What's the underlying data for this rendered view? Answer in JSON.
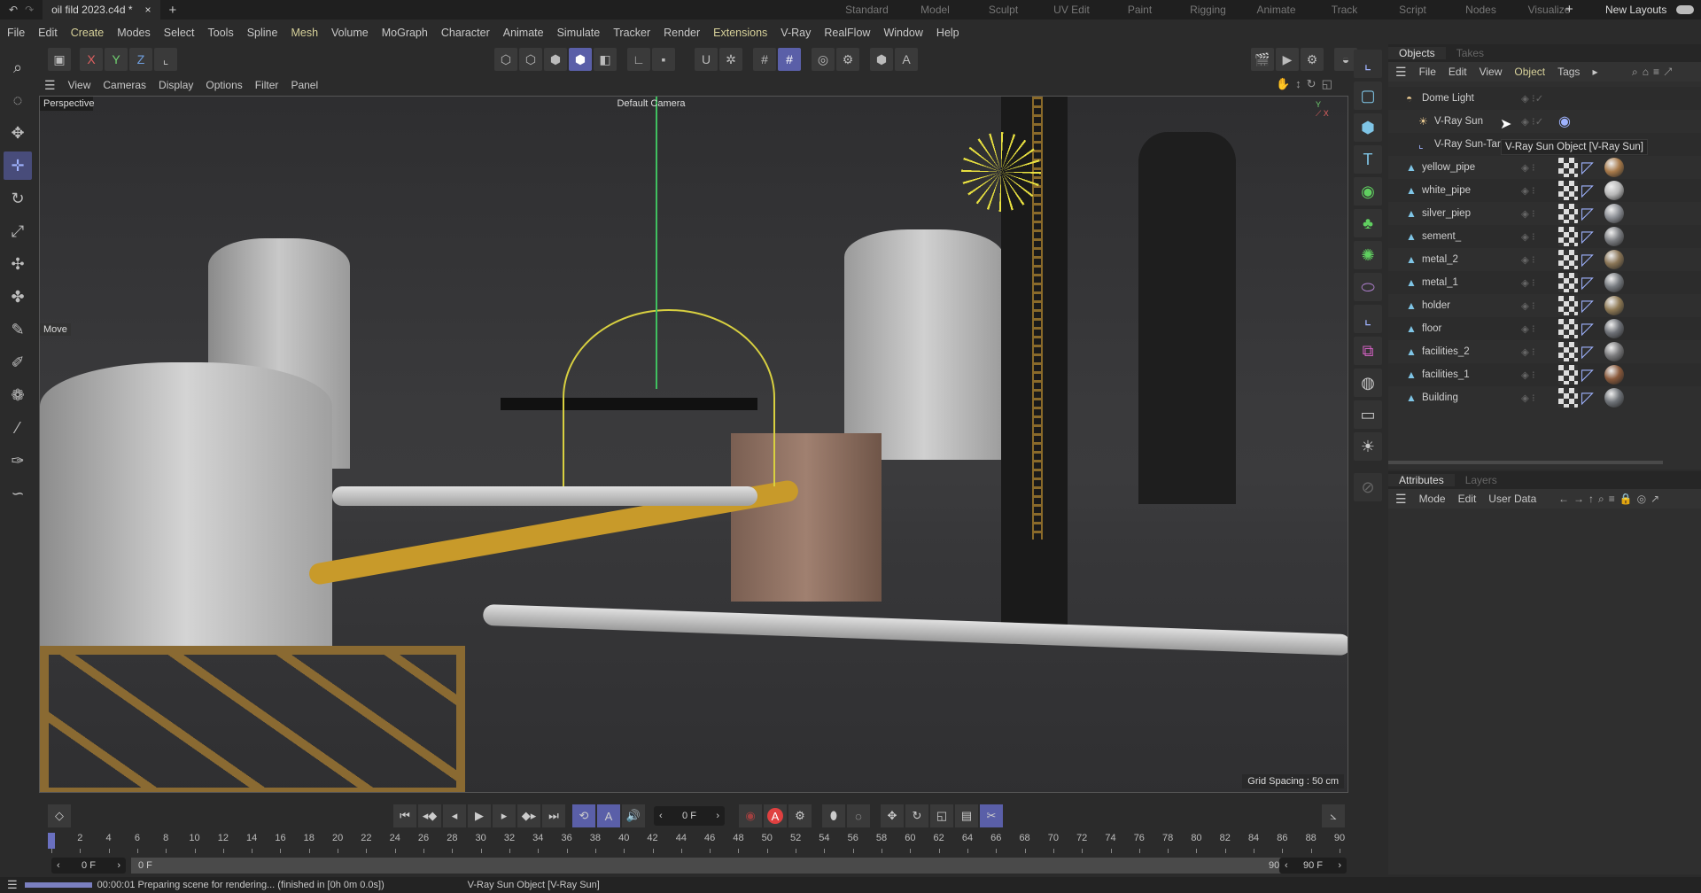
{
  "titlebar": {
    "doc_tab": "oil fild 2023.c4d *",
    "close": "×",
    "add": "+",
    "layouts": [
      "Standard",
      "Model",
      "Sculpt",
      "UV Edit",
      "Paint",
      "Rigging",
      "Animate",
      "Track",
      "Script",
      "Nodes",
      "Visualize"
    ],
    "add_layout": "+",
    "new_layouts": "New Layouts"
  },
  "menubar": [
    "File",
    "Edit",
    "Create",
    "Modes",
    "Select",
    "Tools",
    "Spline",
    "Mesh",
    "Volume",
    "MoGraph",
    "Character",
    "Animate",
    "Simulate",
    "Tracker",
    "Render",
    "Extensions",
    "V-Ray",
    "RealFlow",
    "Window",
    "Help"
  ],
  "menubar_highlighted": [
    "Create",
    "Mesh",
    "Extensions"
  ],
  "toolbar": {
    "axis_x": "X",
    "axis_y": "Y",
    "axis_z": "Z"
  },
  "viewport": {
    "menu": [
      "View",
      "Cameras",
      "Display",
      "Options",
      "Filter",
      "Panel"
    ],
    "name": "Perspective",
    "camera": "Default Camera",
    "tool_label": "Move",
    "grid_spacing": "Grid Spacing : 50 cm"
  },
  "objects_panel": {
    "tabs": [
      "Objects",
      "Takes"
    ],
    "menu": [
      "File",
      "Edit",
      "View",
      "Object",
      "Tags"
    ],
    "items": [
      {
        "name": "Dome Light",
        "icon": "dome-light-icon",
        "depth": 0
      },
      {
        "name": "V-Ray Sun",
        "icon": "sun-icon",
        "depth": 1
      },
      {
        "name": "V-Ray Sun-Targ",
        "icon": "target-icon",
        "depth": 1
      },
      {
        "name": "yellow_pipe",
        "icon": "polygon-object-icon",
        "depth": 0,
        "material": "#a87a4a"
      },
      {
        "name": "white_pipe",
        "icon": "polygon-object-icon",
        "depth": 0,
        "material": "#b8b8b8"
      },
      {
        "name": "silver_piep",
        "icon": "polygon-object-icon",
        "depth": 0,
        "material": "#8c8f95"
      },
      {
        "name": "sement_",
        "icon": "polygon-object-icon",
        "depth": 0,
        "material": "#7c7e82"
      },
      {
        "name": "metal_2",
        "icon": "polygon-object-icon",
        "depth": 0,
        "material": "#8a7556"
      },
      {
        "name": "metal_1",
        "icon": "polygon-object-icon",
        "depth": 0,
        "material": "#777b80"
      },
      {
        "name": "holder",
        "icon": "polygon-object-icon",
        "depth": 0,
        "material": "#8f7a55"
      },
      {
        "name": "floor",
        "icon": "polygon-object-icon",
        "depth": 0,
        "material": "#6e7177"
      },
      {
        "name": "facilities_2",
        "icon": "polygon-object-icon",
        "depth": 0,
        "material": "#7a7a7c"
      },
      {
        "name": "facilities_1",
        "icon": "polygon-object-icon",
        "depth": 0,
        "material": "#8a5a3c"
      },
      {
        "name": "Building",
        "icon": "polygon-object-icon",
        "depth": 0,
        "material": "#6f7378"
      }
    ],
    "tooltip": "V-Ray Sun Object [V-Ray Sun]"
  },
  "attributes_panel": {
    "tabs": [
      "Attributes",
      "Layers"
    ],
    "menu": [
      "Mode",
      "Edit",
      "User Data"
    ]
  },
  "timeline": {
    "current_frame": "0 F",
    "range_start": "0 F",
    "range_start_inner": "0 F",
    "range_end_inner": "90 F",
    "range_end": "90 F",
    "ruler_min": 0,
    "ruler_max": 90,
    "ruler_step": 2,
    "playhead": 0
  },
  "statusbar": {
    "progress": 1.0,
    "message": "00:00:01 Preparing scene for rendering... (finished in [0h  0m  0.0s])",
    "hint": "V-Ray Sun Object [V-Ray Sun]"
  },
  "colors": {
    "accent": "#5a5fa8",
    "highlight_menu": "#d7d19a"
  }
}
